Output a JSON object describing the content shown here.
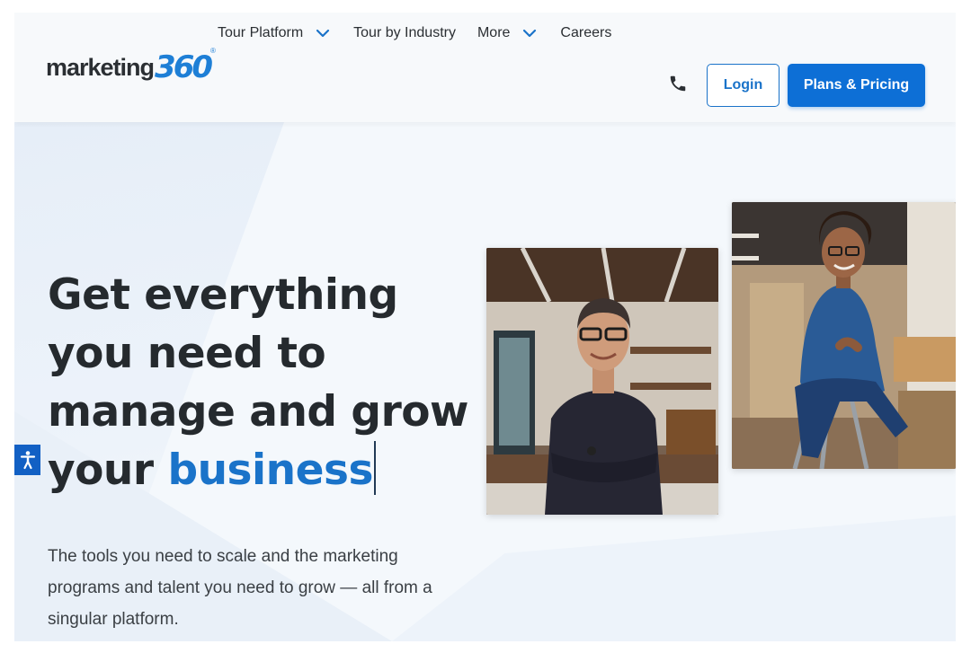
{
  "header": {
    "logo": {
      "word": "marketing",
      "number": "360",
      "reg": "®"
    },
    "nav": [
      {
        "label": "Tour Platform",
        "dropdown": true
      },
      {
        "label": "Tour by Industry",
        "dropdown": false
      },
      {
        "label": "More",
        "dropdown": true
      },
      {
        "label": "Careers",
        "dropdown": false
      }
    ],
    "login_label": "Login",
    "plans_label": "Plans & Pricing",
    "phone_icon": "phone-icon"
  },
  "hero": {
    "headline_line1": "Get everything",
    "headline_line2": "you need to",
    "headline_line3": "manage and grow",
    "headline_line4_plain": "your",
    "headline_line4_accent": "business",
    "subtext": "The tools you need to scale and the marketing programs and talent you need to grow — all from a singular platform."
  },
  "colors": {
    "accent": "#1a73c9",
    "primary_button": "#0d6fd6",
    "text_dark": "#252a2e",
    "background": "#f4f8fc"
  },
  "icons": [
    "chevron-down-icon",
    "phone-icon",
    "accessibility-icon"
  ]
}
